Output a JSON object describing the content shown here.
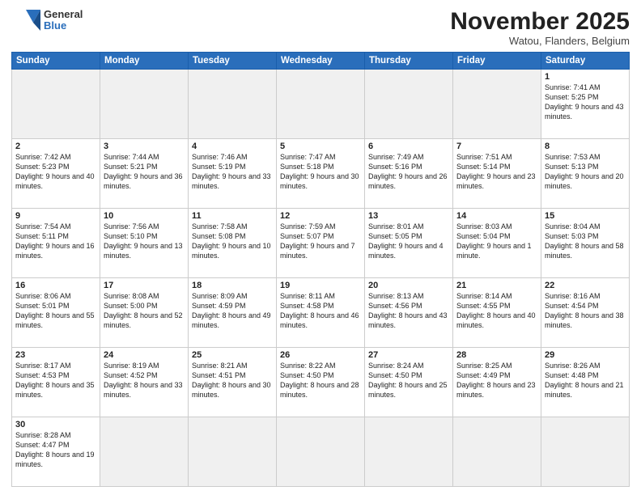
{
  "header": {
    "logo_general": "General",
    "logo_blue": "Blue",
    "month_title": "November 2025",
    "location": "Watou, Flanders, Belgium"
  },
  "weekdays": [
    "Sunday",
    "Monday",
    "Tuesday",
    "Wednesday",
    "Thursday",
    "Friday",
    "Saturday"
  ],
  "weeks": [
    [
      {
        "day": "",
        "info": ""
      },
      {
        "day": "",
        "info": ""
      },
      {
        "day": "",
        "info": ""
      },
      {
        "day": "",
        "info": ""
      },
      {
        "day": "",
        "info": ""
      },
      {
        "day": "",
        "info": ""
      },
      {
        "day": "1",
        "info": "Sunrise: 7:41 AM\nSunset: 5:25 PM\nDaylight: 9 hours and 43 minutes."
      }
    ],
    [
      {
        "day": "2",
        "info": "Sunrise: 7:42 AM\nSunset: 5:23 PM\nDaylight: 9 hours and 40 minutes."
      },
      {
        "day": "3",
        "info": "Sunrise: 7:44 AM\nSunset: 5:21 PM\nDaylight: 9 hours and 36 minutes."
      },
      {
        "day": "4",
        "info": "Sunrise: 7:46 AM\nSunset: 5:19 PM\nDaylight: 9 hours and 33 minutes."
      },
      {
        "day": "5",
        "info": "Sunrise: 7:47 AM\nSunset: 5:18 PM\nDaylight: 9 hours and 30 minutes."
      },
      {
        "day": "6",
        "info": "Sunrise: 7:49 AM\nSunset: 5:16 PM\nDaylight: 9 hours and 26 minutes."
      },
      {
        "day": "7",
        "info": "Sunrise: 7:51 AM\nSunset: 5:14 PM\nDaylight: 9 hours and 23 minutes."
      },
      {
        "day": "8",
        "info": "Sunrise: 7:53 AM\nSunset: 5:13 PM\nDaylight: 9 hours and 20 minutes."
      }
    ],
    [
      {
        "day": "9",
        "info": "Sunrise: 7:54 AM\nSunset: 5:11 PM\nDaylight: 9 hours and 16 minutes."
      },
      {
        "day": "10",
        "info": "Sunrise: 7:56 AM\nSunset: 5:10 PM\nDaylight: 9 hours and 13 minutes."
      },
      {
        "day": "11",
        "info": "Sunrise: 7:58 AM\nSunset: 5:08 PM\nDaylight: 9 hours and 10 minutes."
      },
      {
        "day": "12",
        "info": "Sunrise: 7:59 AM\nSunset: 5:07 PM\nDaylight: 9 hours and 7 minutes."
      },
      {
        "day": "13",
        "info": "Sunrise: 8:01 AM\nSunset: 5:05 PM\nDaylight: 9 hours and 4 minutes."
      },
      {
        "day": "14",
        "info": "Sunrise: 8:03 AM\nSunset: 5:04 PM\nDaylight: 9 hours and 1 minute."
      },
      {
        "day": "15",
        "info": "Sunrise: 8:04 AM\nSunset: 5:03 PM\nDaylight: 8 hours and 58 minutes."
      }
    ],
    [
      {
        "day": "16",
        "info": "Sunrise: 8:06 AM\nSunset: 5:01 PM\nDaylight: 8 hours and 55 minutes."
      },
      {
        "day": "17",
        "info": "Sunrise: 8:08 AM\nSunset: 5:00 PM\nDaylight: 8 hours and 52 minutes."
      },
      {
        "day": "18",
        "info": "Sunrise: 8:09 AM\nSunset: 4:59 PM\nDaylight: 8 hours and 49 minutes."
      },
      {
        "day": "19",
        "info": "Sunrise: 8:11 AM\nSunset: 4:58 PM\nDaylight: 8 hours and 46 minutes."
      },
      {
        "day": "20",
        "info": "Sunrise: 8:13 AM\nSunset: 4:56 PM\nDaylight: 8 hours and 43 minutes."
      },
      {
        "day": "21",
        "info": "Sunrise: 8:14 AM\nSunset: 4:55 PM\nDaylight: 8 hours and 40 minutes."
      },
      {
        "day": "22",
        "info": "Sunrise: 8:16 AM\nSunset: 4:54 PM\nDaylight: 8 hours and 38 minutes."
      }
    ],
    [
      {
        "day": "23",
        "info": "Sunrise: 8:17 AM\nSunset: 4:53 PM\nDaylight: 8 hours and 35 minutes."
      },
      {
        "day": "24",
        "info": "Sunrise: 8:19 AM\nSunset: 4:52 PM\nDaylight: 8 hours and 33 minutes."
      },
      {
        "day": "25",
        "info": "Sunrise: 8:21 AM\nSunset: 4:51 PM\nDaylight: 8 hours and 30 minutes."
      },
      {
        "day": "26",
        "info": "Sunrise: 8:22 AM\nSunset: 4:50 PM\nDaylight: 8 hours and 28 minutes."
      },
      {
        "day": "27",
        "info": "Sunrise: 8:24 AM\nSunset: 4:50 PM\nDaylight: 8 hours and 25 minutes."
      },
      {
        "day": "28",
        "info": "Sunrise: 8:25 AM\nSunset: 4:49 PM\nDaylight: 8 hours and 23 minutes."
      },
      {
        "day": "29",
        "info": "Sunrise: 8:26 AM\nSunset: 4:48 PM\nDaylight: 8 hours and 21 minutes."
      }
    ],
    [
      {
        "day": "30",
        "info": "Sunrise: 8:28 AM\nSunset: 4:47 PM\nDaylight: 8 hours and 19 minutes."
      },
      {
        "day": "",
        "info": ""
      },
      {
        "day": "",
        "info": ""
      },
      {
        "day": "",
        "info": ""
      },
      {
        "day": "",
        "info": ""
      },
      {
        "day": "",
        "info": ""
      },
      {
        "day": "",
        "info": ""
      }
    ]
  ]
}
